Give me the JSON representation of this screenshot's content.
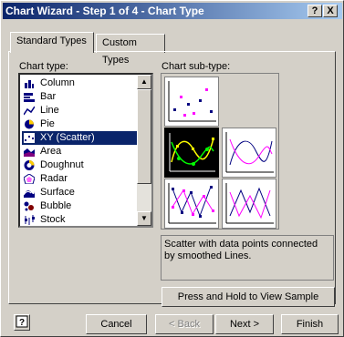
{
  "window": {
    "title": "Chart Wizard - Step 1 of 4 - Chart Type",
    "help_glyph": "?",
    "close_glyph": "X"
  },
  "tabs": [
    {
      "label": "Standard Types"
    },
    {
      "label": "Custom Types"
    }
  ],
  "chart_type_label": "Chart type:",
  "chart_subtype_label": "Chart sub-type:",
  "chart_types": [
    {
      "label": "Column"
    },
    {
      "label": "Bar"
    },
    {
      "label": "Line"
    },
    {
      "label": "Pie"
    },
    {
      "label": "XY (Scatter)"
    },
    {
      "label": "Area"
    },
    {
      "label": "Doughnut"
    },
    {
      "label": "Radar"
    },
    {
      "label": "Surface"
    },
    {
      "label": "Bubble"
    },
    {
      "label": "Stock"
    }
  ],
  "description": "Scatter with data points connected by smoothed Lines.",
  "buttons": {
    "press_hold": "Press and Hold to View Sample",
    "cancel": "Cancel",
    "back": "< Back",
    "next": "Next >",
    "finish": "Finish"
  },
  "colors": {
    "title_start": "#0a246a",
    "title_end": "#a6caf0",
    "selection": "#0a246a",
    "face": "#d4d0c8"
  }
}
